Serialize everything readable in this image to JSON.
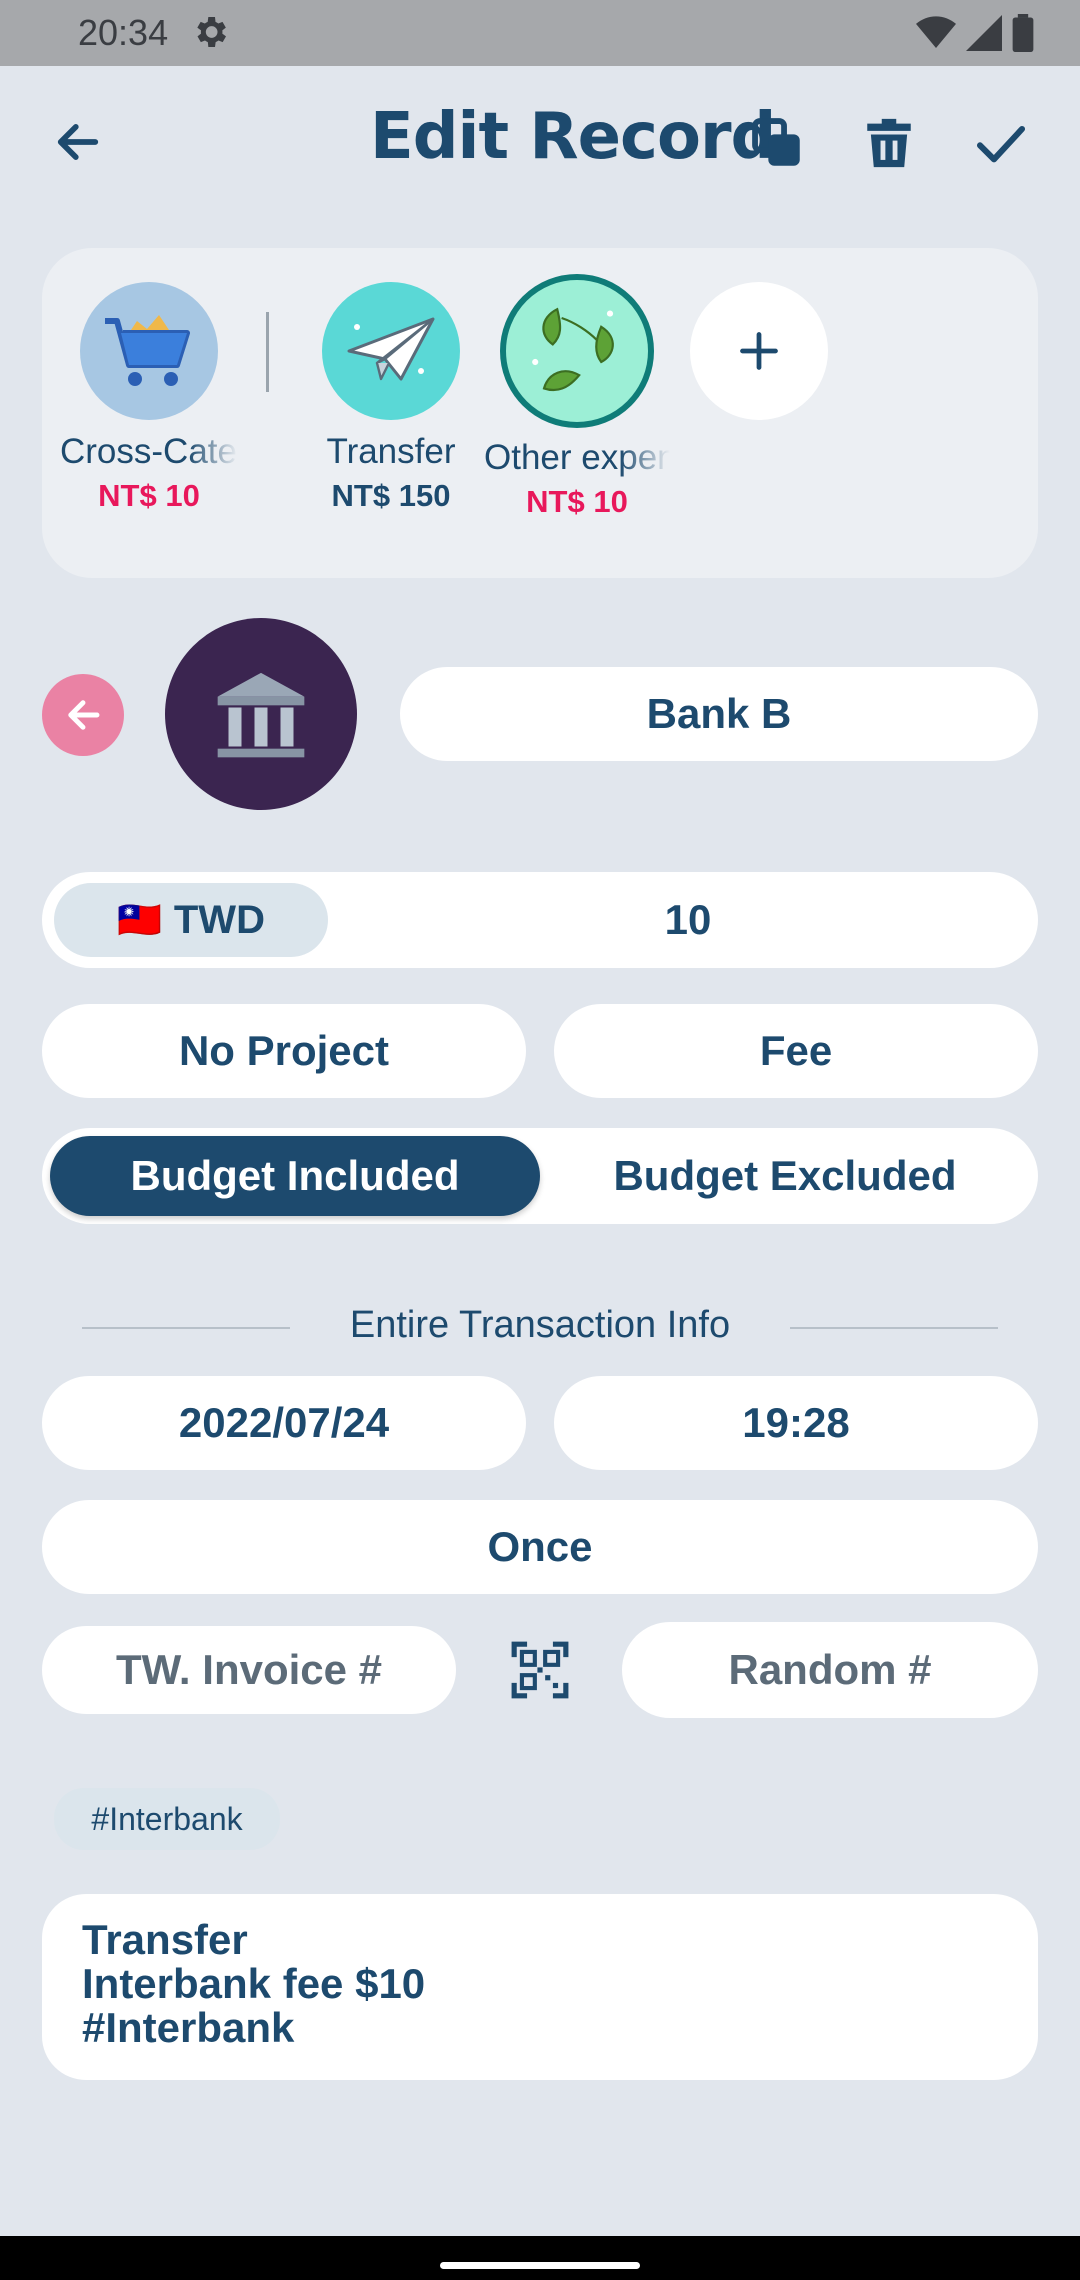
{
  "status_bar": {
    "time": "20:34"
  },
  "header": {
    "title": "Edit Record"
  },
  "categories": [
    {
      "name": "Cross-Category",
      "amount": "NT$ 10",
      "amount_color": "#e8185b"
    },
    {
      "name": "Transfer",
      "amount": "NT$ 150",
      "amount_color": "#1d4a6e"
    },
    {
      "name": "Other expense",
      "amount": "NT$ 10",
      "amount_color": "#e8185b"
    }
  ],
  "account": {
    "name": "Bank B"
  },
  "amount_row": {
    "flag": "🇹🇼",
    "currency": "TWD",
    "value": "10"
  },
  "project_row": {
    "project": "No Project",
    "type": "Fee"
  },
  "budget": {
    "included": "Budget Included",
    "excluded": "Budget Excluded",
    "selected": "included"
  },
  "section": {
    "label": "Entire Transaction Info"
  },
  "datetime": {
    "date": "2022/07/24",
    "time": "19:28"
  },
  "repeat": {
    "value": "Once"
  },
  "invoice": {
    "number_placeholder": "TW. Invoice #",
    "random_placeholder": "Random #"
  },
  "tags": [
    "#Interbank"
  ],
  "note": {
    "lines": [
      "Transfer",
      "Interbank fee $10",
      "#Interbank"
    ]
  },
  "colors": {
    "primary": "#1d4a6e",
    "background": "#e1e6ed",
    "accent_pink": "#e8185b",
    "back_circle": "#ea82a4",
    "bank_circle": "#3b2550"
  }
}
